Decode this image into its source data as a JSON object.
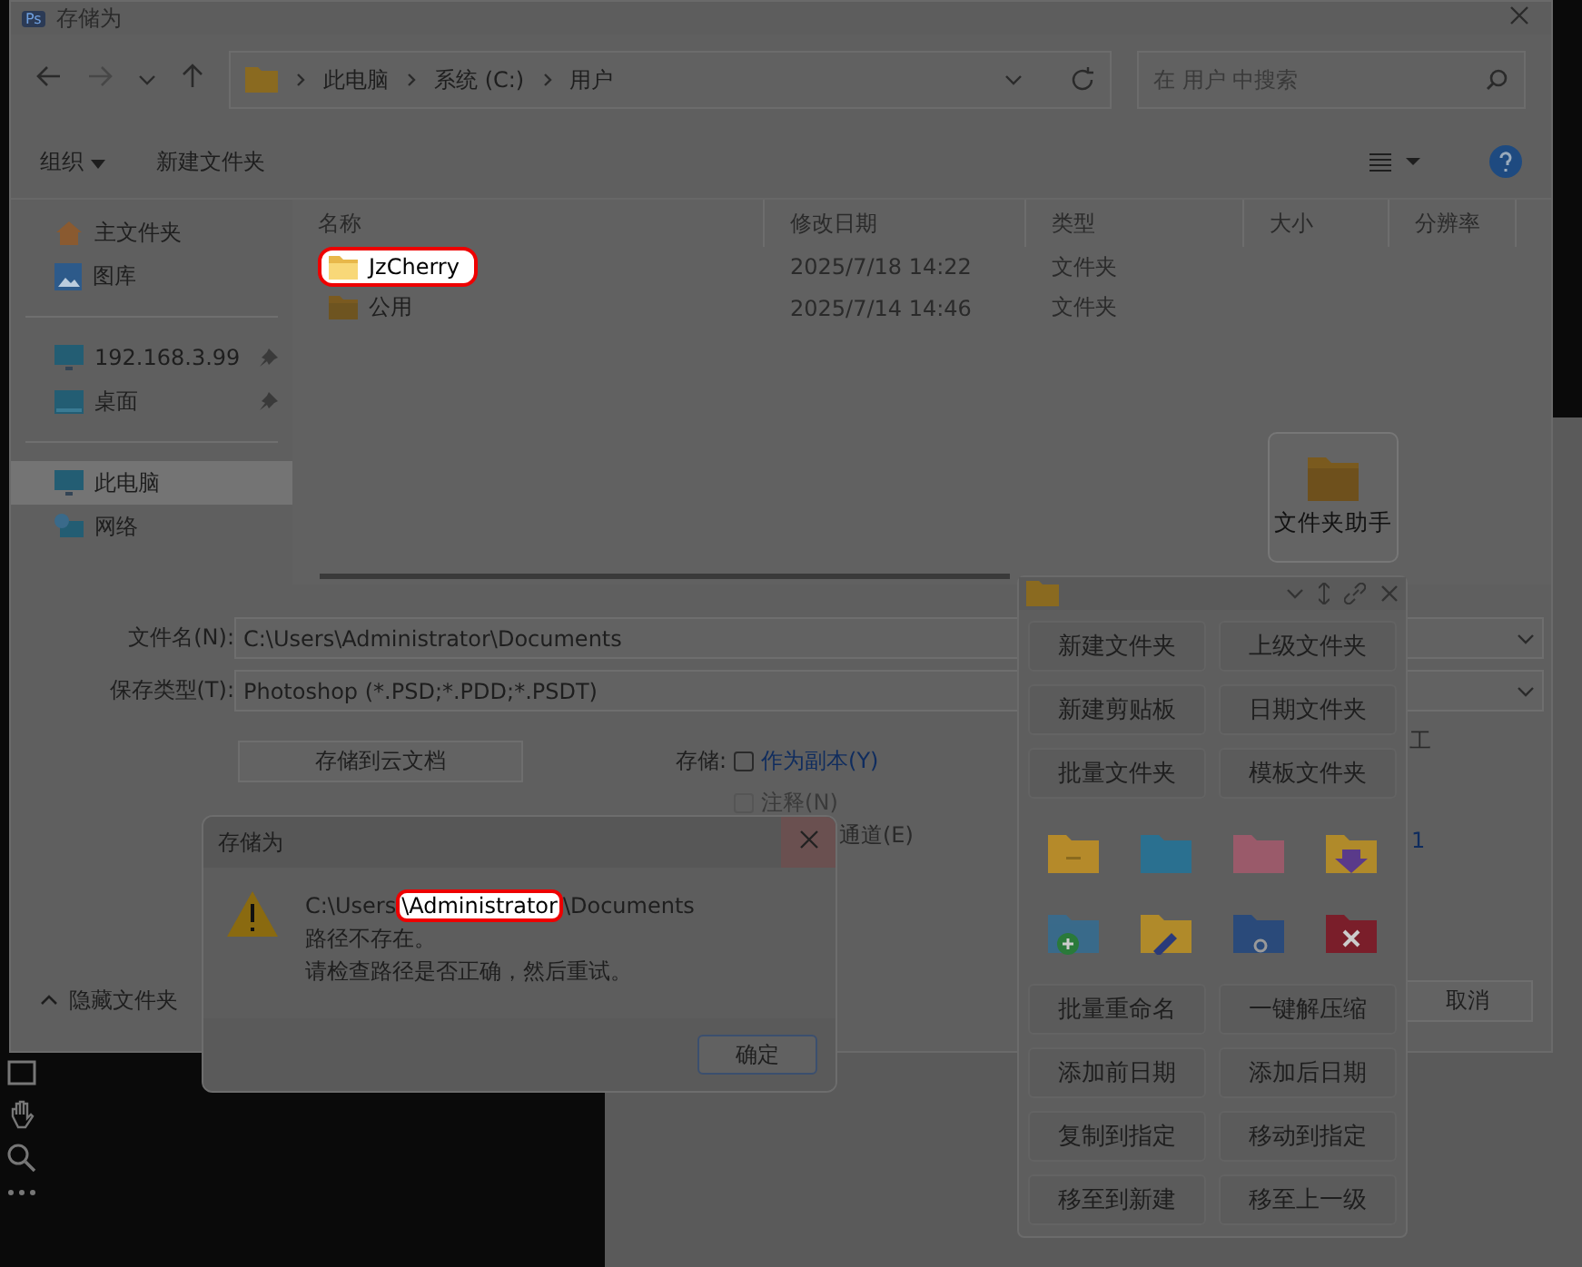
{
  "window": {
    "title": "存储为",
    "app_badge": "Ps"
  },
  "nav": {
    "breadcrumb": [
      "此电脑",
      "系统 (C:)",
      "用户"
    ],
    "search": {
      "placeholder": "在 用户 中搜索"
    }
  },
  "toolbar": {
    "organize": "组织",
    "new_folder": "新建文件夹"
  },
  "sidebar": {
    "groups": [
      [
        {
          "label": "主文件夹",
          "kind": "home",
          "pinned": false,
          "selected": false
        },
        {
          "label": "图库",
          "kind": "gallery",
          "pinned": false,
          "selected": false
        }
      ],
      [
        {
          "label": "192.168.3.99",
          "kind": "monitor",
          "pinned": true,
          "selected": false
        },
        {
          "label": "桌面",
          "kind": "desktop",
          "pinned": true,
          "selected": false
        }
      ],
      [
        {
          "label": "此电脑",
          "kind": "monitor",
          "pinned": false,
          "selected": true
        },
        {
          "label": "网络",
          "kind": "network",
          "pinned": false,
          "selected": false
        }
      ]
    ]
  },
  "table": {
    "columns": [
      "名称",
      "修改日期",
      "类型",
      "大小",
      "分辨率"
    ],
    "rows": [
      {
        "name": "JzCherry",
        "modified": "2025/7/18 14:22",
        "type": "文件夹",
        "highlighted": true
      },
      {
        "name": "公用",
        "modified": "2025/7/14 14:46",
        "type": "文件夹",
        "highlighted": false
      }
    ]
  },
  "helper_button": {
    "label": "文件夹助手"
  },
  "form": {
    "filename_label": "文件名(N):",
    "filename": "C:\\Users\\Administrator\\Documents",
    "type_label": "保存类型(T):",
    "type": "Photoshop (*.PSD;*.PDD;*.PSDT)",
    "cloud_button": "存储到云文档",
    "save_label": "存储:",
    "options": [
      {
        "label": "作为副本(Y)",
        "checked": false,
        "disabled": false
      },
      {
        "label": "注释(N)",
        "checked": false,
        "disabled": true
      }
    ],
    "covered_option": "通道(E)",
    "fragments": [
      "工",
      "1"
    ]
  },
  "footer": {
    "hide_folders": "隐藏文件夹",
    "cancel": "取消"
  },
  "alert": {
    "title": "存储为",
    "path": {
      "before": "C:\\Users",
      "highlight": "\\Administrator",
      "after": "\\Documents"
    },
    "lines": [
      "路径不存在。",
      "请检查路径是否正确，然后重试。"
    ],
    "ok": "确定"
  },
  "helper": {
    "top_buttons": [
      "新建文件夹",
      "上级文件夹",
      "新建剪贴板",
      "日期文件夹",
      "批量文件夹",
      "模板文件夹"
    ],
    "bottom_buttons": [
      "批量重命名",
      "一键解压缩",
      "添加前日期",
      "添加后日期",
      "复制到指定",
      "移动到指定",
      "移至到新建",
      "移至上一级"
    ]
  }
}
